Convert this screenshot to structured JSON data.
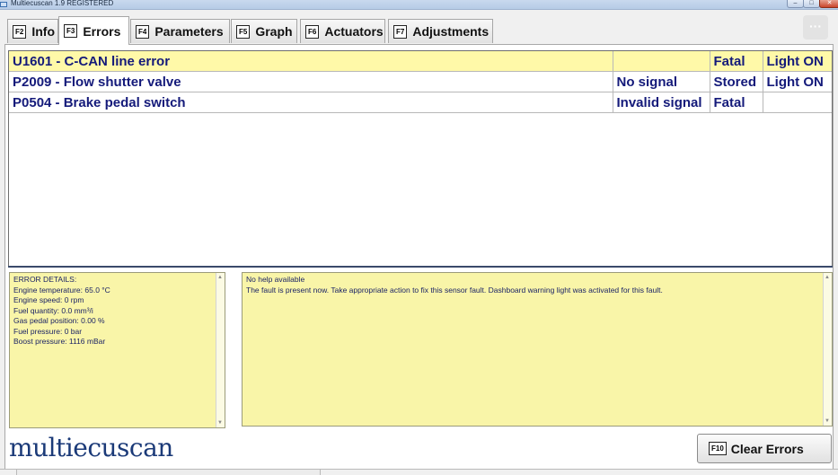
{
  "window": {
    "title": "Multiecuscan 1.9 REGISTERED",
    "minimize_glyph": "–",
    "maximize_glyph": "□",
    "close_glyph": "✕"
  },
  "tabs": [
    {
      "key": "F2",
      "label": "Info"
    },
    {
      "key": "F3",
      "label": "Errors",
      "active": true
    },
    {
      "key": "F4",
      "label": "Parameters"
    },
    {
      "key": "F5",
      "label": "Graph"
    },
    {
      "key": "F6",
      "label": "Actuators"
    },
    {
      "key": "F7",
      "label": "Adjustments"
    }
  ],
  "menu_button": {
    "glyph": "···"
  },
  "errors": [
    {
      "code_desc": "U1601 - C-CAN line error",
      "condition": "",
      "status": "Fatal",
      "light": "Light ON",
      "selected": true
    },
    {
      "code_desc": "P2009 - Flow shutter valve",
      "condition": "No signal",
      "status": "Stored",
      "light": "Light ON"
    },
    {
      "code_desc": "P0504 - Brake pedal switch",
      "condition": "Invalid signal",
      "status": "Fatal",
      "light": ""
    }
  ],
  "details": {
    "heading": "ERROR DETAILS:",
    "lines": [
      "Engine temperature: 65.0 °C",
      "Engine speed: 0 rpm",
      "Fuel quantity: 0.0 mm³/i",
      "Gas pedal position: 0.00 %",
      "Fuel pressure: 0 bar",
      "Boost pressure: 1116 mBar"
    ]
  },
  "help": {
    "line1": "No help available",
    "line2": "The fault is present now. Take appropriate action to fix this sensor fault. Dashboard warning light was activated for this fault."
  },
  "scroll_arrows": {
    "up": "▲",
    "down": "▼"
  },
  "logo": {
    "text": "multiecuscan"
  },
  "clear_button": {
    "key": "F10",
    "label": "Clear Errors"
  },
  "colors": {
    "accent_text": "#141a7a",
    "selected_row": "#fff9a8",
    "pane_bg": "#f9f5a8",
    "logo": "#1b3a78"
  }
}
